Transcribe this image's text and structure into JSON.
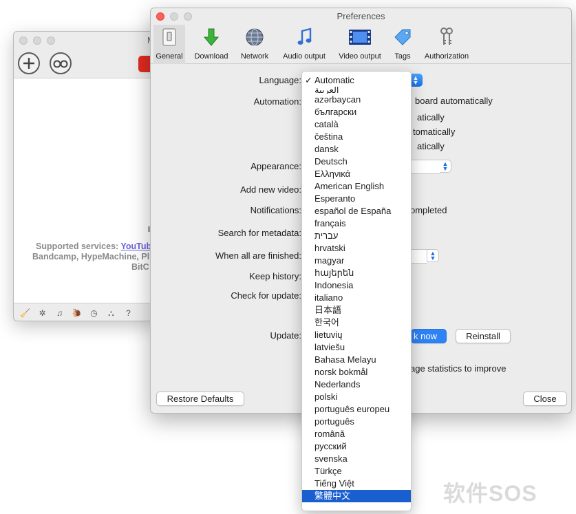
{
  "background_window": {
    "title_fragment": "M",
    "supported_label": "Supported services:",
    "supported_link": "YouTub",
    "supported_line2": "Bandcamp, HypeMachine, Pl",
    "supported_line3": "BitC",
    "bottom_icons": [
      "broom-icon",
      "gear-icon",
      "music-note-icon",
      "snail-icon",
      "clock-icon",
      "binoculars-icon",
      "help-icon"
    ],
    "bottom_glyphs": [
      "🧹",
      "✲",
      "♫",
      "🐌",
      "◷",
      "⛬",
      "?"
    ]
  },
  "prefs": {
    "title": "Preferences",
    "tabs": [
      {
        "label": "General",
        "icon": "general-switch-icon"
      },
      {
        "label": "Download",
        "icon": "download-arrow-icon"
      },
      {
        "label": "Network",
        "icon": "globe-icon"
      },
      {
        "label": "Audio output",
        "icon": "music-note-icon"
      },
      {
        "label": "Video output",
        "icon": "film-icon"
      },
      {
        "label": "Tags",
        "icon": "tag-icon"
      },
      {
        "label": "Authorization",
        "icon": "keys-icon"
      }
    ],
    "labels": {
      "language": "Language:",
      "automation": "Automation:",
      "appearance": "Appearance:",
      "add_new_video": "Add new video:",
      "notifications": "Notifications:",
      "search_metadata": "Search for metadata:",
      "when_finished": "When all are finished:",
      "keep_history": "Keep history:",
      "check_update": "Check for update:",
      "update": "Update:"
    },
    "visible_fragments": {
      "automation_1": "board automatically",
      "automation_2": "atically",
      "automation_3": "tomatically",
      "automation_4": "atically",
      "notifications": "ompleted",
      "usage": "age statistics to improve"
    },
    "buttons": {
      "check_now_fragment": "k now",
      "reinstall": "Reinstall",
      "restore_defaults": "Restore Defaults",
      "close": "Close"
    }
  },
  "language_menu": {
    "selected_check": "✓",
    "items": [
      "Automatic",
      "العربية",
      "azərbaycan",
      "български",
      "català",
      "čeština",
      "dansk",
      "Deutsch",
      "Ελληνικά",
      "American English",
      "Esperanto",
      "español de España",
      "français",
      "עברית",
      "hrvatski",
      "magyar",
      "հայերեն",
      "Indonesia",
      "italiano",
      "日本語",
      "한국어",
      "lietuvių",
      "latviešu",
      "Bahasa Melayu",
      "norsk bokmål",
      "Nederlands",
      "polski",
      "português europeu",
      "português",
      "română",
      "русский",
      "svenska",
      "Türkçe",
      "Tiếng Việt",
      "繁體中文"
    ],
    "checked_index": 0,
    "highlighted_index": 34
  },
  "watermark": "软件SOS",
  "colors": {
    "accent_blue": "#2f82f5",
    "menu_highlight": "#1a5fd0",
    "close_red": "#fe5f57",
    "youtube_red": "#e02b20",
    "link_purple": "#6b62d9"
  }
}
